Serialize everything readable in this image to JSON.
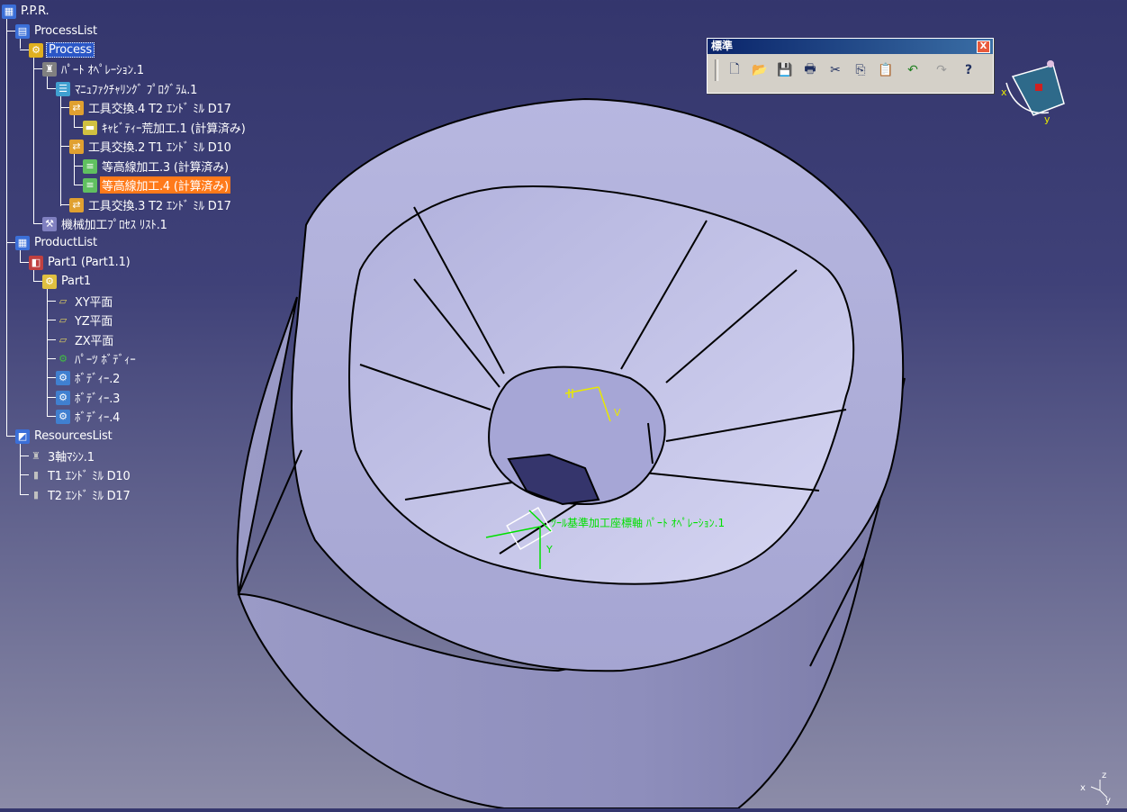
{
  "tree": {
    "items": [
      {
        "label": "P.P.R.",
        "icon": "ppr-icon",
        "color": "#3b6fd8"
      },
      {
        "label": "ProcessList",
        "icon": "process-list-icon",
        "color": "#3b6fd8"
      },
      {
        "label": "Process",
        "icon": "process-gear-icon",
        "color": "#e0b020"
      },
      {
        "label": "ﾊﾟｰﾄ ｵﾍﾟﾚｰｼｮﾝ.1",
        "icon": "part-operation-icon",
        "color": "#c0c0c0"
      },
      {
        "label": "ﾏﾆｭﾌｧｸﾁｬﾘﾝｸﾞ ﾌﾟﾛｸﾞﾗﾑ.1",
        "icon": "manufacturing-program-icon",
        "color": "#40a0d0"
      },
      {
        "label": "工具交換.4  T2 ｴﾝﾄﾞ ﾐﾙ D17",
        "icon": "tool-change-icon",
        "color": "#e0a030"
      },
      {
        "label": "ｷｬﾋﾞﾃｨｰ荒加工.1 (計算済み)",
        "icon": "roughing-icon",
        "color": "#d0c040"
      },
      {
        "label": "工具交換.2  T1 ｴﾝﾄﾞ ﾐﾙ D10",
        "icon": "tool-change-icon",
        "color": "#e0a030"
      },
      {
        "label": "等高線加工.3 (計算済み)",
        "icon": "zlevel-icon",
        "color": "#60c060"
      },
      {
        "label": "等高線加工.4 (計算済み)",
        "icon": "zlevel-icon",
        "color": "#60c060"
      },
      {
        "label": "工具交換.3  T2 ｴﾝﾄﾞ ﾐﾙ D17",
        "icon": "tool-change-icon",
        "color": "#e0a030"
      },
      {
        "label": "機械加工ﾌﾟﾛｾｽ ﾘｽﾄ.1",
        "icon": "machining-process-icon",
        "color": "#8080c0"
      },
      {
        "label": "ProductList",
        "icon": "product-list-icon",
        "color": "#3b6fd8"
      },
      {
        "label": "Part1 (Part1.1)",
        "icon": "product-icon",
        "color": "#c04040"
      },
      {
        "label": "Part1",
        "icon": "part-icon",
        "color": "#e0c040"
      },
      {
        "label": "XY平面",
        "icon": "plane-icon",
        "color": "#e0d060"
      },
      {
        "label": "YZ平面",
        "icon": "plane-icon",
        "color": "#e0d060"
      },
      {
        "label": "ZX平面",
        "icon": "plane-icon",
        "color": "#e0d060"
      },
      {
        "label": "ﾊﾟｰﾂ ﾎﾞﾃﾞｨｰ",
        "icon": "part-body-icon",
        "color": "#40c040"
      },
      {
        "label": "ﾎﾞﾃﾞｨｰ.2",
        "icon": "body-icon",
        "color": "#4080d0"
      },
      {
        "label": "ﾎﾞﾃﾞｨｰ.3",
        "icon": "body-icon",
        "color": "#4080d0"
      },
      {
        "label": "ﾎﾞﾃﾞｨｰ.4",
        "icon": "body-icon",
        "color": "#4080d0"
      },
      {
        "label": "ResourcesList",
        "icon": "resources-list-icon",
        "color": "#3b6fd8"
      },
      {
        "label": "3軸ﾏｼﾝ.1",
        "icon": "machine-icon",
        "color": "#c0c0c0"
      },
      {
        "label": "T1 ｴﾝﾄﾞ ﾐﾙ D10",
        "icon": "end-mill-icon",
        "color": "#c0c0c0"
      },
      {
        "label": "T2 ｴﾝﾄﾞ ﾐﾙ D17",
        "icon": "end-mill-icon",
        "color": "#c0c0c0"
      }
    ]
  },
  "toolbar": {
    "title": "標準",
    "close_label": "X",
    "buttons": [
      {
        "name": "new-icon",
        "glyph": "🗋"
      },
      {
        "name": "open-icon",
        "glyph": "📂"
      },
      {
        "name": "save-icon",
        "glyph": "💾"
      },
      {
        "name": "print-icon",
        "glyph": "🖶"
      },
      {
        "name": "cut-icon",
        "glyph": "✂"
      },
      {
        "name": "copy-icon",
        "glyph": "⎘"
      },
      {
        "name": "paste-icon",
        "glyph": "📋"
      },
      {
        "name": "undo-icon",
        "glyph": "↶"
      },
      {
        "name": "redo-icon",
        "glyph": "↷"
      },
      {
        "name": "whats-this-icon",
        "glyph": "?"
      }
    ]
  },
  "viewport": {
    "axis_label_local": "ﾂｰﾙ基準加工座標軸 ﾊﾟｰﾄ ｵﾍﾟﾚｰｼｮﾝ.1",
    "local_axis_y": "Y",
    "inner_axis_v": "V",
    "inner_axis_h": "H",
    "compass_x": "x",
    "compass_y": "y",
    "corner_axis_x": "x",
    "corner_axis_y": "y",
    "corner_axis_z": "z"
  },
  "colors": {
    "highlight": "#ff7a1a",
    "selection": "#2a56c6",
    "part_face": "#a8a8d8",
    "axis_green": "#00e000",
    "axis_yellow": "#e8e800"
  }
}
